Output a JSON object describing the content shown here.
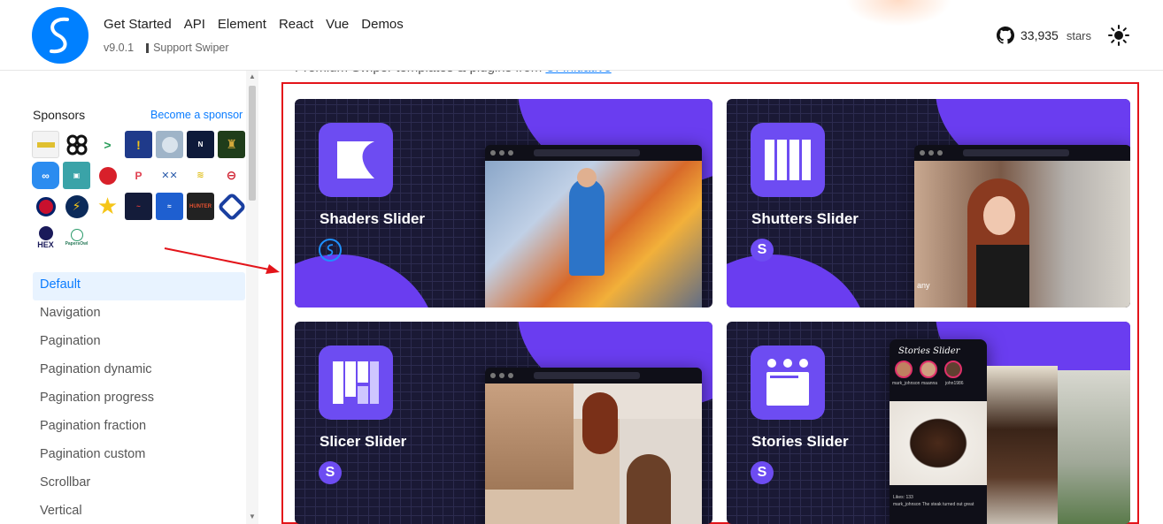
{
  "header": {
    "nav": [
      "Get Started",
      "API",
      "Element",
      "React",
      "Vue",
      "Demos"
    ],
    "version": "v9.0.1",
    "support_label": "Support Swiper",
    "github_stars": "33,935",
    "stars_label": "stars",
    "icons": [
      "swiper-logo",
      "github-icon",
      "sun-icon"
    ]
  },
  "sidebar": {
    "sponsors_title": "Sponsors",
    "become_sponsor": "Become a sponsor",
    "sponsor_logo_text": [
      "HEX",
      "PapersOwl",
      "HUNTER"
    ],
    "menu": [
      {
        "label": "Default",
        "active": true
      },
      {
        "label": "Navigation",
        "active": false
      },
      {
        "label": "Pagination",
        "active": false
      },
      {
        "label": "Pagination dynamic",
        "active": false
      },
      {
        "label": "Pagination progress",
        "active": false
      },
      {
        "label": "Pagination fraction",
        "active": false
      },
      {
        "label": "Pagination custom",
        "active": false
      },
      {
        "label": "Scrollbar",
        "active": false
      },
      {
        "label": "Vertical",
        "active": false
      }
    ]
  },
  "main": {
    "promo_prefix": "Premium Swiper templates & plugins from ",
    "promo_link": "UI Initiative",
    "cards": [
      {
        "title": "Shaders Slider"
      },
      {
        "title": "Shutters Slider",
        "overlay_text": "any"
      },
      {
        "title": "Slicer Slider"
      },
      {
        "title": "Stories Slider",
        "preview_title": "Stories Slider",
        "preview_users": [
          "mark_johnson",
          "maanna",
          "john1986"
        ],
        "preview_likes": "Likes: 133",
        "preview_caption": "mark_johnson The steak turned out great"
      }
    ]
  },
  "colors": {
    "accent": "#0a7cff",
    "card_bg": "#1a1935",
    "card_purple": "#6d4cf2",
    "highlight_box": "#e3141a"
  }
}
